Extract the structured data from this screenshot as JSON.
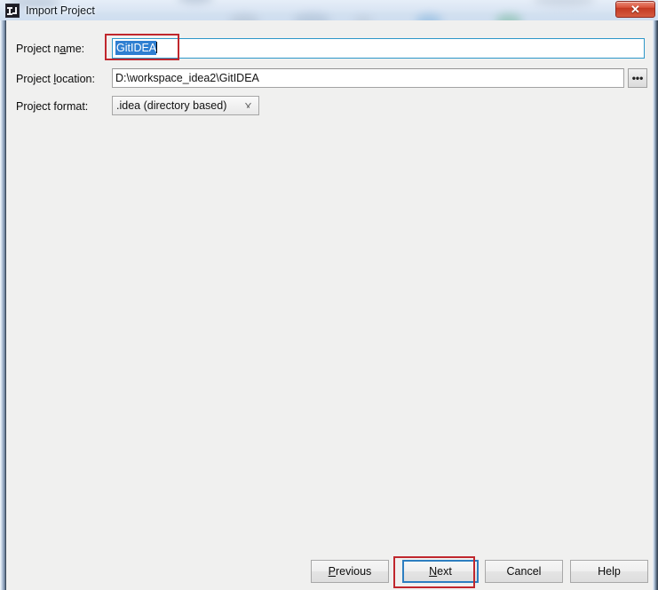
{
  "window": {
    "title": "Import Project",
    "app_icon": "intellij-idea-icon",
    "close_label": "✕"
  },
  "form": {
    "rows": [
      {
        "label_prefix": "Project n",
        "label_mnemonic": "a",
        "label_suffix": "me:",
        "value": "GitIDEA",
        "control": "text-input"
      },
      {
        "label_prefix": "Project ",
        "label_mnemonic": "l",
        "label_suffix": "ocation:",
        "value": "D:\\workspace_idea2\\GitIDEA",
        "control": "text-input-with-browse",
        "browse_label": "•••",
        "browse_icon": "ellipsis-icon"
      },
      {
        "label_prefix": "Project format:",
        "label_mnemonic": "",
        "label_suffix": "",
        "value": ".idea (directory based)",
        "control": "combobox",
        "dropdown_icon": "chevron-down-icon"
      }
    ]
  },
  "buttons": {
    "previous": {
      "prefix": "",
      "mnemonic": "P",
      "suffix": "revious"
    },
    "next": {
      "prefix": "",
      "mnemonic": "N",
      "suffix": "ext"
    },
    "cancel": {
      "prefix": "Cancel",
      "mnemonic": "",
      "suffix": ""
    },
    "help": {
      "prefix": "Help",
      "mnemonic": "",
      "suffix": ""
    }
  },
  "annotations": {
    "name_field_highlight": "red-rectangle-around-project-name-value",
    "next_button_highlight": "red-rectangle-around-next-button"
  },
  "colors": {
    "annotation_red": "#c0272d",
    "focus_blue": "#2d7ec0",
    "selection_blue": "#2f7fd1",
    "dialog_background": "#f0f0ef",
    "titlebar_glass": "#dbe6f4",
    "close_button_red": "#c33a23"
  }
}
